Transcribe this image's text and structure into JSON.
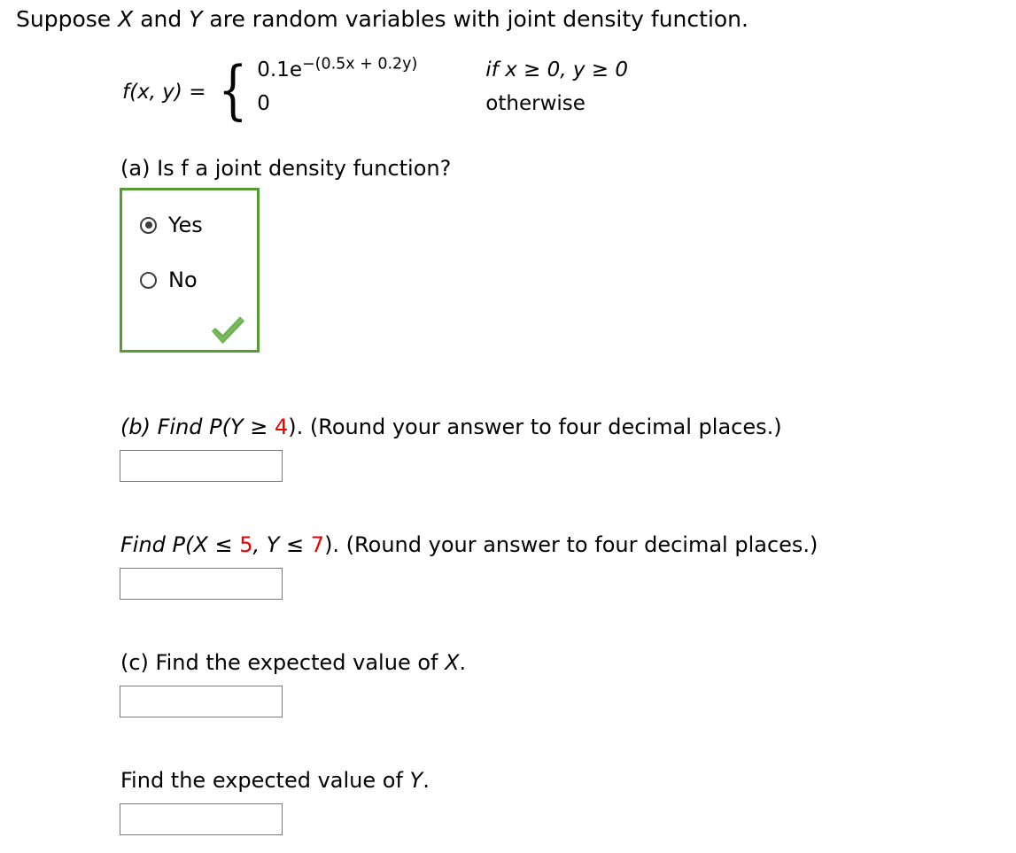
{
  "problem": {
    "stem_prefix": "Suppose ",
    "stem_var1": "X",
    "stem_mid": " and ",
    "stem_var2": "Y",
    "stem_suffix": " are random variables with joint density function."
  },
  "formula": {
    "function_label": "f(x, y)  =",
    "case1_value_base": "0.1e",
    "case1_value_exponent": "−(0.5x + 0.2y)",
    "case1_condition": "if x ≥ 0, y ≥ 0",
    "case2_value": "0",
    "case2_condition": "otherwise"
  },
  "part_a": {
    "question": "(a) Is f a joint density function?",
    "options": [
      {
        "label": "Yes",
        "selected": true
      },
      {
        "label": "No",
        "selected": false
      }
    ],
    "feedback_icon": "green-check-icon",
    "box_border_color": "#569c36",
    "check_color": "#6bb14f"
  },
  "part_b": {
    "question_prefix": "(b) Find P(Y ≥ ",
    "question_value": "4",
    "question_suffix": "). (Round your answer to four decimal places.)",
    "answer_value": "",
    "question2_prefix": "Find P(X ≤ ",
    "question2_value1": "5",
    "question2_mid": ", Y ≤ ",
    "question2_value2": "7",
    "question2_suffix": "). (Round your answer to four decimal places.)",
    "answer2_value": ""
  },
  "part_c": {
    "question_prefix": "(c) Find the expected value of ",
    "question_var": "X",
    "question_suffix": ".",
    "answer_value": "",
    "question2_prefix": "Find the expected value of ",
    "question2_var": "Y",
    "question2_suffix": ".",
    "answer2_value": ""
  },
  "colors": {
    "red": "#ee0000",
    "green_border": "#569c36",
    "green_check": "#6bb14f",
    "input_border": "#7a7a7a"
  }
}
